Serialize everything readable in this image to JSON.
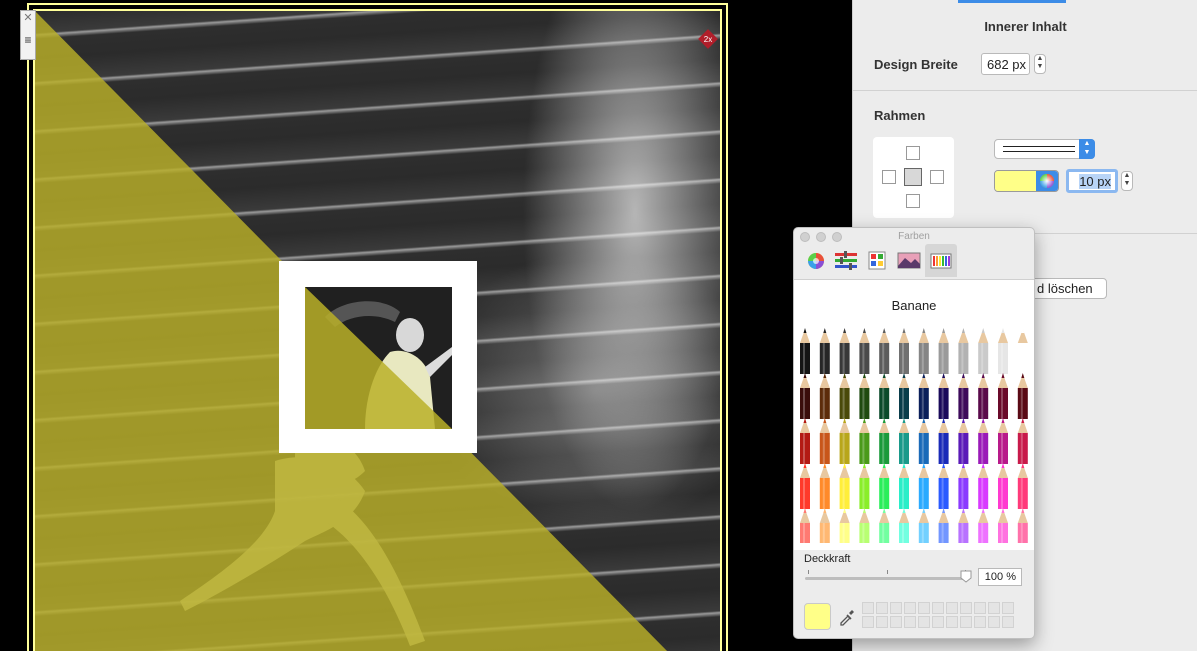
{
  "canvas": {
    "badge_text": "2x",
    "close_glyph": "✕",
    "menu_glyph": "≡",
    "overlay_color": "#bab028",
    "frame_color": "#ffff9a"
  },
  "inspector": {
    "section_title": "Innerer Inhalt",
    "design_width_label": "Design Breite",
    "design_width_value": "682 px",
    "border_section_label": "Rahmen",
    "border_width_value": "10 px",
    "border_color": "#ffff88",
    "delete_button_label": "d löschen",
    "accent_color": "#3c8ce7",
    "icons": {
      "stepper": "stepper-icon",
      "line_style": "line-style-icon",
      "color_wheel": "color-wheel-icon"
    }
  },
  "colors_panel": {
    "title": "Farben",
    "tabs": [
      {
        "icon": "color-wheel-icon"
      },
      {
        "icon": "sliders-icon"
      },
      {
        "icon": "palettes-icon"
      },
      {
        "icon": "image-palettes-icon"
      },
      {
        "icon": "pencils-icon",
        "selected": true
      }
    ],
    "palette_name": "Banane",
    "opacity_label": "Deckkraft",
    "opacity_value": "100 %",
    "opacity_fraction": 1.0,
    "current_color": "#ffff88",
    "pencil_colors": [
      [
        "#151515",
        "#262626",
        "#383838",
        "#4a4a4a",
        "#5c5c5c",
        "#707070",
        "#858585",
        "#9a9a9a",
        "#b2b2b2",
        "#cacaca",
        "#e6e6e6",
        "#ffffff"
      ],
      [
        "#3a0d0b",
        "#5c2c0a",
        "#4a4a0a",
        "#1f4a10",
        "#0b4a2a",
        "#0a3d4a",
        "#0a1f5a",
        "#1a0a5a",
        "#3d0a5a",
        "#5a0a4a",
        "#6a0a2a",
        "#5a0a15"
      ],
      [
        "#b31a14",
        "#c8561a",
        "#b8a61a",
        "#4a9a1a",
        "#1a9a3a",
        "#1a9a8a",
        "#1a6ab8",
        "#1a2ab8",
        "#5a1ab8",
        "#9a1ab8",
        "#b81a8a",
        "#c81a4a"
      ],
      [
        "#ff3a2a",
        "#ff8a2a",
        "#ffee3a",
        "#8aee2a",
        "#2aee5a",
        "#2aeec8",
        "#2aaaff",
        "#2a5aff",
        "#8a3aff",
        "#d83aff",
        "#ff3ad0",
        "#ff3a7a"
      ],
      [
        "#ff7a72",
        "#ffb872",
        "#ffff88",
        "#b8ff72",
        "#72ffa0",
        "#72ffe0",
        "#72d0ff",
        "#7296ff",
        "#b872ff",
        "#ee72ff",
        "#ff72e0",
        "#ff72aa"
      ]
    ]
  }
}
